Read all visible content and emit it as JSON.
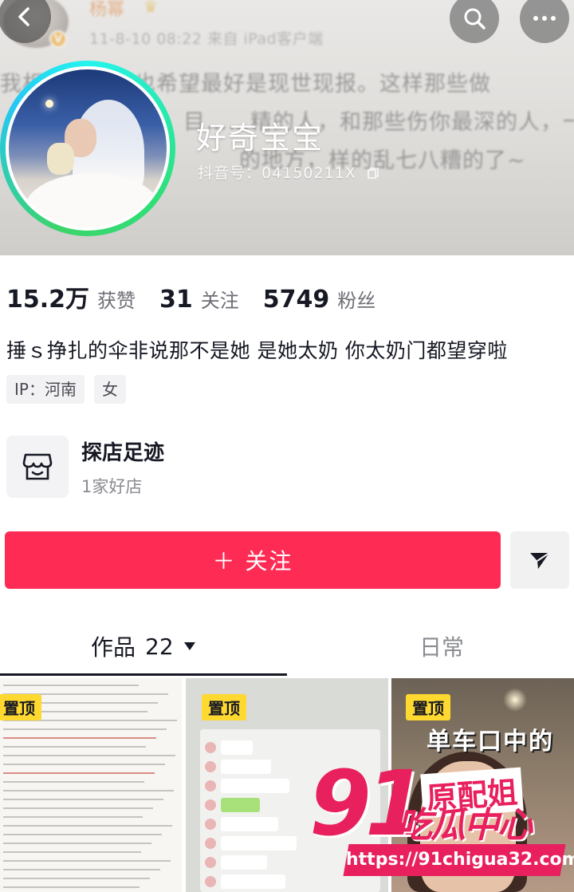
{
  "cover": {
    "weibo_name": "杨幂",
    "weibo_meta": "11-8-10 08:22  来自 iPad客户端",
    "weibo_lines": [
      "我相信一方，也希望最好是现世现报。这样那些做",
      "目……精的人，和那些伤你最深的人，一定",
      "的地方，样的乱七八糟的了~"
    ]
  },
  "profile": {
    "nickname": "好奇宝宝",
    "douyin_id": "抖音号：04150211X"
  },
  "stats": [
    {
      "num": "15.2万",
      "label": "获赞"
    },
    {
      "num": "31",
      "label": "关注"
    },
    {
      "num": "5749",
      "label": "粉丝"
    }
  ],
  "bio": "捶ｓ挣扎的伞非说那不是她 是她太奶 你太奶门都望穿啦",
  "tags": [
    "IP：河南",
    "女"
  ],
  "shop": {
    "title": "探店足迹",
    "subtitle": "1家好店"
  },
  "actions": {
    "follow_label": "＋ 关注"
  },
  "tabs": {
    "works_label": "作品",
    "works_count": "22",
    "daily_label": "日常"
  },
  "grid": {
    "pin_label": "置顶",
    "tile3_title": "单车口中的",
    "tile3_badge": "原配姐"
  },
  "watermark": {
    "brand_num": "91",
    "brand_cn": "吃瓜中心",
    "url": "https://91chigua32.com"
  },
  "colors": {
    "follow": "#fe2c55",
    "accent_ring": "#25f4ee",
    "pin": "#ffd930",
    "watermark": "#e8205e"
  },
  "icons": [
    "back-icon",
    "search-icon",
    "more-icon",
    "copy-icon",
    "shop-icon",
    "share-icon",
    "caret-down-icon"
  ]
}
